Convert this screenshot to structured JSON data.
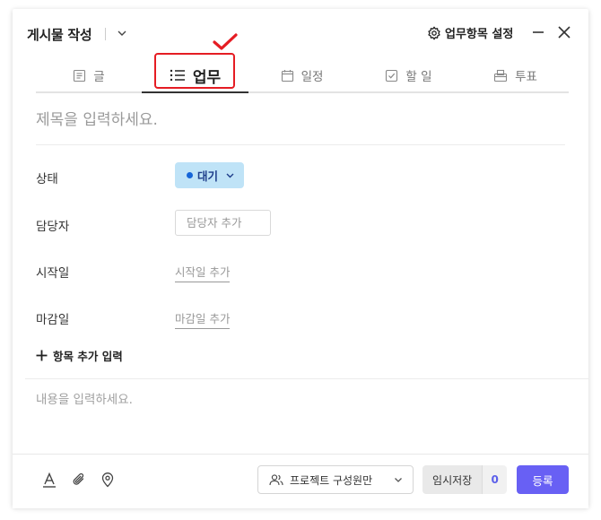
{
  "header": {
    "title": "게시물 작성",
    "settings_label": "업무항목 설정"
  },
  "tabs": [
    {
      "label": "글",
      "icon": "document-icon"
    },
    {
      "label": "업무",
      "icon": "list-icon",
      "active": true
    },
    {
      "label": "일정",
      "icon": "calendar-icon"
    },
    {
      "label": "할 일",
      "icon": "checkbox-icon"
    },
    {
      "label": "투표",
      "icon": "ballot-box-icon"
    }
  ],
  "form": {
    "subject_placeholder": "제목을 입력하세요.",
    "status_label": "상태",
    "status_value": "대기",
    "assignee_label": "담당자",
    "assignee_placeholder": "담당자 추가",
    "start_label": "시작일",
    "start_placeholder": "시작일 추가",
    "due_label": "마감일",
    "due_placeholder": "마감일 추가",
    "add_field_label": "항목 추가 입력",
    "content_placeholder": "내용을 입력하세요."
  },
  "footer": {
    "scope_label": "프로젝트 구성원만",
    "draft_label": "임시저장",
    "draft_count": "0",
    "submit_label": "등록"
  },
  "colors": {
    "accent": "#6860f4",
    "status_bg": "#bfe3f7",
    "status_dot": "#1565d8",
    "highlight": "#e51c23",
    "draft_count": "#5b5fea"
  }
}
